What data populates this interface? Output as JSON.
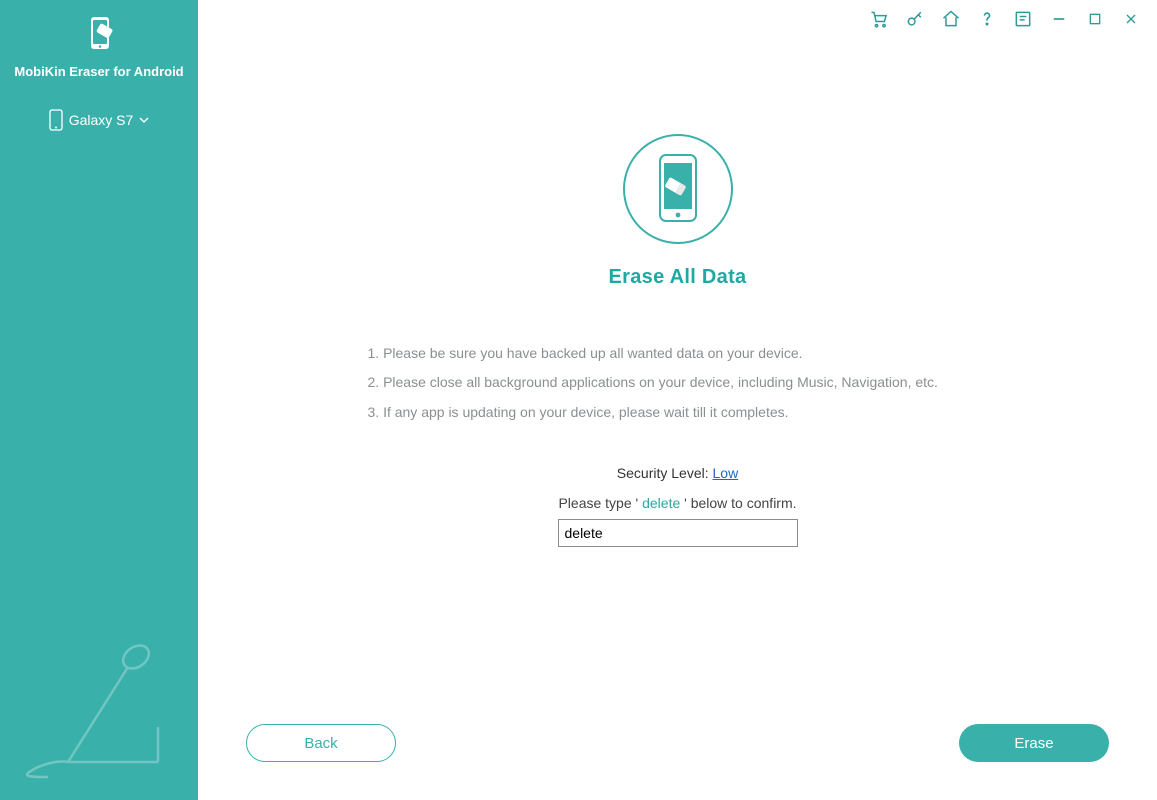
{
  "sidebar": {
    "app_title": "MobiKin Eraser for Android",
    "device_name": "Galaxy S7"
  },
  "titlebar_icons": {
    "cart": "cart-icon",
    "key": "key-icon",
    "home": "home-icon",
    "help": "help-icon",
    "feedback": "feedback-icon",
    "minimize": "minimize-icon",
    "maximize": "maximize-icon",
    "close": "close-icon"
  },
  "main": {
    "heading": "Erase All Data",
    "instructions": [
      "1. Please be sure you have backed up all wanted data on your device.",
      "2. Please close all background applications on your device, including Music, Navigation, etc.",
      "3. If any app is updating on your device, please wait till it completes."
    ],
    "security_label": "Security Level:",
    "security_value": "Low",
    "confirm_prefix": "Please type '",
    "confirm_keyword": "delete",
    "confirm_suffix": "' below to confirm.",
    "input_value": "delete"
  },
  "footer": {
    "back_label": "Back",
    "erase_label": "Erase"
  },
  "colors": {
    "accent": "#3ab0ab",
    "link": "#2166c7",
    "text_muted": "#8a8f92"
  }
}
